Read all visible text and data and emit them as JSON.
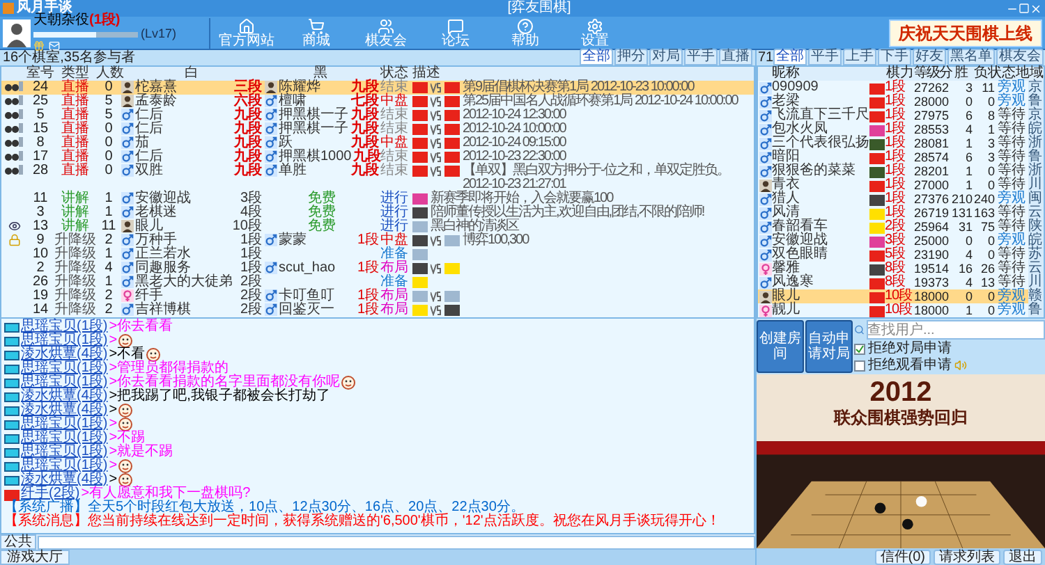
{
  "window": {
    "title": "风月手谈",
    "subtitle": "[弈友围棋]"
  },
  "user": {
    "name": "天朝杂役",
    "rank": "(1段)",
    "level": 0.6,
    "lv": "(Lv17)"
  },
  "nav": [
    {
      "label": "官方网站",
      "kind": "home"
    },
    {
      "label": "商城",
      "kind": "cart"
    },
    {
      "label": "棋友会",
      "kind": "club"
    },
    {
      "label": "论坛",
      "kind": "forum"
    },
    {
      "label": "帮助",
      "kind": "help"
    },
    {
      "label": "设置",
      "kind": "settings"
    }
  ],
  "banner": "庆祝天天围棋上线",
  "games": {
    "title": "16个棋室,35名参与者",
    "tabs": [
      {
        "label": "全部",
        "selected": true
      },
      {
        "label": "押分",
        "selected": false
      },
      {
        "label": "对局",
        "selected": false
      },
      {
        "label": "平手",
        "selected": false
      },
      {
        "label": "直播",
        "selected": false
      }
    ],
    "columns": [
      "室号",
      "类型",
      "人数",
      "白",
      "黑",
      "状态",
      "描述"
    ],
    "rows": [
      {
        "marker": {
          "kind": "live"
        },
        "room": "24",
        "type": {
          "label": "直播",
          "kind": "live"
        },
        "count": "0",
        "white": {
          "name": "柁嘉熹",
          "rank": "三段"
        },
        "black": {
          "name": "陈耀烨",
          "rank": "九段"
        },
        "status": {
          "label": "结束",
          "kind": "ended"
        },
        "icons": [
          {
            "kind": "cn"
          },
          {
            "kind": "cn"
          }
        ],
        "vs": true,
        "text": "第9届倡棋杯决赛第1局 2012-10-23 10:00:00",
        "selected": true
      },
      {
        "marker": {
          "kind": "live"
        },
        "room": "25",
        "type": {
          "label": "直播",
          "kind": "live"
        },
        "count": "5",
        "white": {
          "name": "孟泰龄",
          "rank": "六段"
        },
        "black": {
          "kind": "male",
          "name": "檀啸",
          "rank": "七段"
        },
        "status": {
          "label": "中盘",
          "kind": "mid"
        },
        "icons": [
          {
            "kind": "cn"
          },
          {
            "kind": "cn"
          }
        ],
        "vs": true,
        "text": "第25届中国名人战循环赛第1局 2012-10-24 10:00:00",
        "selected": false
      },
      {
        "marker": {
          "kind": "live"
        },
        "room": "5",
        "type": {
          "label": "直播",
          "kind": "live"
        },
        "count": "5",
        "white": {
          "kind": "male",
          "name": "仁后",
          "rank": "九段"
        },
        "black": {
          "kind": "male",
          "name": "押黑棋一子",
          "rank": "九段"
        },
        "status": {
          "label": "结束",
          "kind": "ended"
        },
        "icons": [
          {
            "kind": "cn"
          },
          {
            "kind": "cn"
          }
        ],
        "vs": true,
        "text": "2012-10-24 12:30:00",
        "selected": false
      },
      {
        "marker": {
          "kind": "live"
        },
        "room": "15",
        "type": {
          "label": "直播",
          "kind": "live"
        },
        "count": "0",
        "white": {
          "kind": "male",
          "name": "仁后",
          "rank": "九段"
        },
        "black": {
          "kind": "male",
          "name": "押黑棋一子",
          "rank": "九段"
        },
        "status": {
          "label": "结束",
          "kind": "ended"
        },
        "icons": [
          {
            "kind": "cn"
          },
          {
            "kind": "cn"
          }
        ],
        "vs": true,
        "text": "2012-10-24 10:00:00",
        "selected": false
      },
      {
        "marker": {
          "kind": "live"
        },
        "room": "8",
        "type": {
          "label": "直播",
          "kind": "live"
        },
        "count": "0",
        "white": {
          "kind": "male",
          "name": "茄",
          "rank": "九段"
        },
        "black": {
          "kind": "male",
          "name": "跃",
          "rank": "九段"
        },
        "status": {
          "label": "中盘",
          "kind": "mid"
        },
        "icons": [
          {
            "kind": "cn"
          },
          {
            "kind": "cn"
          }
        ],
        "vs": true,
        "text": "2012-10-24 09:15:00",
        "selected": false
      },
      {
        "marker": {
          "kind": "live"
        },
        "room": "17",
        "type": {
          "label": "直播",
          "kind": "live"
        },
        "count": "0",
        "white": {
          "kind": "male",
          "name": "仁后",
          "rank": "九段"
        },
        "black": {
          "kind": "male",
          "name": "押黑棋1000",
          "rank": "九段"
        },
        "status": {
          "label": "结束",
          "kind": "ended"
        },
        "icons": [
          {
            "kind": "cn"
          },
          {
            "kind": "cn"
          }
        ],
        "vs": true,
        "text": "2012-10-23 22:30:00",
        "selected": false
      },
      {
        "marker": {
          "kind": "live"
        },
        "room": "28",
        "type": {
          "label": "直播",
          "kind": "live"
        },
        "count": "0",
        "white": {
          "kind": "male",
          "name": "双胜",
          "rank": "九段"
        },
        "black": {
          "kind": "male",
          "name": "单胜",
          "rank": "九段"
        },
        "status": {
          "label": "结束",
          "kind": "ended"
        },
        "icons": [
          {
            "kind": "cn"
          },
          {
            "kind": "cn"
          }
        ],
        "vs": true,
        "text": "【单双】黑白双方押分于-位之和，单双定胜负。 2012-10-23 21:27:01",
        "selected": false
      },
      {
        "room": "11",
        "type": {
          "label": "讲解",
          "kind": "lecture"
        },
        "count": "1",
        "white": {
          "kind": "male",
          "name": "安徽迎战",
          "rank": "3段"
        },
        "free": "免费",
        "status": {
          "label": "进行",
          "kind": "running"
        },
        "icons": [
          {
            "kind": "pink"
          }
        ],
        "vs": false,
        "text": "新赛季即将开始，入会就要赢100",
        "selected": false
      },
      {
        "room": "3",
        "type": {
          "label": "讲解",
          "kind": "lecture"
        },
        "count": "1",
        "white": {
          "kind": "male",
          "name": "老棋迷",
          "rank": "4段"
        },
        "free": "免费",
        "status": {
          "label": "进行",
          "kind": "running"
        },
        "icons": [
          {
            "kind": "black"
          }
        ],
        "vs": false,
        "text": "陪师董传授以生活为主,欢迎自由,团结,不限的陪师!",
        "selected": false
      },
      {
        "marker": {
          "kind": "watch"
        },
        "room": "13",
        "type": {
          "label": "讲解",
          "kind": "lecture"
        },
        "count": "11",
        "white": {
          "name": "眼儿",
          "rank": "10段"
        },
        "free": "免费",
        "status": {
          "label": "进行",
          "kind": "running"
        },
        "icons": [
          {
            "kind": "gray"
          }
        ],
        "vs": false,
        "text": "黑白神的清谈区",
        "selected": false
      },
      {
        "marker": {
          "kind": "lock"
        },
        "room": "9",
        "type": {
          "label": "升降级",
          "kind": "ranked"
        },
        "count": "2",
        "white": {
          "kind": "male",
          "name": "万种手",
          "rank": "1段"
        },
        "black": {
          "kind": "male",
          "name": "蒙蒙",
          "rank": "1段"
        },
        "status": {
          "label": "中盘",
          "kind": "mid"
        },
        "icons": [
          {
            "kind": "black"
          },
          {
            "kind": "gray"
          }
        ],
        "vs": true,
        "text": "博弈100,300",
        "selected": false
      },
      {
        "room": "10",
        "type": {
          "label": "升降级",
          "kind": "ranked"
        },
        "count": "1",
        "white": {
          "kind": "male",
          "name": "正兰若水",
          "rank": "1段"
        },
        "status": {
          "label": "准备",
          "kind": "ready"
        },
        "icons": [
          {
            "kind": "gray"
          }
        ],
        "vs": false,
        "selected": false
      },
      {
        "room": "2",
        "type": {
          "label": "升降级",
          "kind": "ranked"
        },
        "count": "4",
        "white": {
          "kind": "male",
          "name": "同趣服务",
          "rank": "1段"
        },
        "black": {
          "kind": "male",
          "name": "scut_hao",
          "rank": "1段"
        },
        "status": {
          "label": "布局",
          "kind": "opening"
        },
        "icons": [
          {
            "kind": "black"
          },
          {
            "kind": "yellow"
          }
        ],
        "vs": true,
        "selected": false
      },
      {
        "room": "26",
        "type": {
          "label": "升降级",
          "kind": "ranked"
        },
        "count": "1",
        "white": {
          "kind": "male",
          "name": "黑老大的大徒弟",
          "rank": "2段"
        },
        "status": {
          "label": "准备",
          "kind": "ready"
        },
        "icons": [
          {
            "kind": "yellow"
          }
        ],
        "vs": false,
        "selected": false
      },
      {
        "room": "19",
        "type": {
          "label": "升降级",
          "kind": "ranked"
        },
        "count": "2",
        "white": {
          "kind": "female",
          "name": "纤手",
          "rank": "2段"
        },
        "black": {
          "kind": "male",
          "name": "卡叮鱼叮",
          "rank": "1段"
        },
        "status": {
          "label": "布局",
          "kind": "opening"
        },
        "icons": [
          {
            "kind": "gray"
          },
          {
            "kind": "gray"
          }
        ],
        "vs": true,
        "selected": false
      },
      {
        "room": "14",
        "type": {
          "label": "升降级",
          "kind": "ranked"
        },
        "count": "2",
        "white": {
          "kind": "male",
          "name": "吉祥博棋",
          "rank": "2段"
        },
        "black": {
          "kind": "male",
          "name": "回鉴灭一",
          "rank": "1段"
        },
        "status": {
          "label": "布局",
          "kind": "opening"
        },
        "icons": [
          {
            "kind": "yellow"
          },
          {
            "kind": "black"
          }
        ],
        "vs": true,
        "selected": false
      }
    ]
  },
  "chat": [
    {
      "kind": "user",
      "name": "思瑶宝贝(1段)",
      "sep": ">",
      "text": "你去看看",
      "color": "#ff00ff"
    },
    {
      "kind": "user",
      "name": "思瑶宝贝(1段)",
      "sep": ">",
      "emoji": true,
      "color": "#ff00ff"
    },
    {
      "kind": "user",
      "name": "淩水烘蕈(4段)",
      "sep": ">",
      "text": "不看",
      "emoji": true,
      "color": "#000000"
    },
    {
      "kind": "user",
      "name": "思瑶宝贝(1段)",
      "sep": ">",
      "text": "管理员都得捐款的",
      "color": "#ff00ff"
    },
    {
      "kind": "user",
      "name": "思瑶宝贝(1段)",
      "sep": ">",
      "text": "你去看看捐款的名字里面都没有你呢",
      "emoji": true,
      "color": "#ff00ff"
    },
    {
      "kind": "user",
      "name": "淩水烘蕈(4段)",
      "sep": ">",
      "text": "把我踢了吧,我银子都被会长打劫了",
      "color": "#000000"
    },
    {
      "kind": "user",
      "name": "淩水烘蕈(4段)",
      "sep": ">",
      "emoji": true,
      "color": "#000000"
    },
    {
      "kind": "user",
      "name": "思瑶宝贝(1段)",
      "sep": ">",
      "emoji": true,
      "color": "#ff00ff"
    },
    {
      "kind": "user",
      "name": "思瑶宝贝(1段)",
      "sep": ">",
      "text": "不踢",
      "color": "#ff00ff"
    },
    {
      "kind": "user",
      "name": "思瑶宝贝(1段)",
      "sep": ">",
      "text": "就是不踢",
      "color": "#ff00ff"
    },
    {
      "kind": "user",
      "name": "思瑶宝贝(1段)",
      "sep": ">",
      "emoji": true,
      "color": "#ff00ff"
    },
    {
      "kind": "user",
      "name": "淩水烘蕈(4段)",
      "sep": ">",
      "emoji": true,
      "color": "#000000"
    },
    {
      "kind": "user",
      "flag": true,
      "name": "纤手(2段)",
      "sep": ">",
      "text": "有人愿意和我下一盘棋吗?",
      "color": "#ff00ff"
    },
    {
      "kind": "system",
      "text": "【系统广播】全天5个时段红包大放送，10点、12点30分、16点、20点、22点30分。",
      "color": "#0066cc"
    },
    {
      "kind": "system",
      "text": "【系统消息】您当前持续在线达到一定时间，获得系统赠送的'6,500'棋币，'12'点活跃度。祝您在风月手谈玩得开心！",
      "color": "#ff0000"
    }
  ],
  "input": {
    "channel": "公共"
  },
  "status_bar": {
    "tab": "游戏大厅"
  },
  "players": {
    "count": "71",
    "tabs": [
      {
        "label": "全部",
        "selected": true
      },
      {
        "label": "平手",
        "selected": false
      },
      {
        "label": "上手",
        "selected": false
      },
      {
        "label": "下手",
        "selected": false
      },
      {
        "label": "好友",
        "selected": false
      },
      {
        "label": "黑名单",
        "selected": false
      },
      {
        "label": "棋友会",
        "selected": false
      }
    ],
    "columns": [
      "昵称",
      "棋力",
      "等级分",
      "胜",
      "负",
      "状态",
      "地域"
    ],
    "rows": [
      {
        "kind": "male",
        "name": "090909",
        "flag": {
          "kind": "cn"
        },
        "rank": "1段",
        "rating": "27262",
        "wins": "3",
        "losses": "11",
        "status": {
          "label": "旁观",
          "kind": "watch"
        },
        "region": "京",
        "selected": false
      },
      {
        "kind": "male",
        "name": "老梁",
        "flag": {
          "kind": "cn"
        },
        "rank": "1段",
        "rating": "28000",
        "wins": "0",
        "losses": "0",
        "status": {
          "label": "旁观",
          "kind": "watch"
        },
        "region": "鲁",
        "selected": false
      },
      {
        "kind": "male",
        "name": "飞流直下三千尺",
        "flag": {
          "kind": "cn"
        },
        "rank": "1段",
        "rating": "27975",
        "wins": "6",
        "losses": "8",
        "status": {
          "label": "等待",
          "kind": "wait"
        },
        "region": "京",
        "selected": false
      },
      {
        "kind": "male",
        "name": "包水火凤",
        "flag": {
          "kind": "pink"
        },
        "rank": "1段",
        "rating": "28553",
        "wins": "4",
        "losses": "1",
        "status": {
          "label": "等待",
          "kind": "wait"
        },
        "region": "皖",
        "selected": false
      },
      {
        "kind": "male",
        "name": "三个代表很弘扬",
        "flag": {
          "kind": "green"
        },
        "rank": "1段",
        "rating": "28081",
        "wins": "1",
        "losses": "3",
        "status": {
          "label": "等待",
          "kind": "wait"
        },
        "region": "浙",
        "selected": false
      },
      {
        "kind": "male",
        "name": "暗阳",
        "flag": {
          "kind": "cn"
        },
        "rank": "1段",
        "rating": "28574",
        "wins": "6",
        "losses": "3",
        "status": {
          "label": "等待",
          "kind": "wait"
        },
        "region": "鲁",
        "selected": false
      },
      {
        "kind": "male",
        "name": "狠狠爸的菜菜",
        "flag": {
          "kind": "green"
        },
        "rank": "1段",
        "rating": "28201",
        "wins": "1",
        "losses": "0",
        "status": {
          "label": "等待",
          "kind": "wait"
        },
        "region": "浙",
        "selected": false
      },
      {
        "name": "青衣",
        "flag": {
          "kind": "cn"
        },
        "rank": "1段",
        "rating": "27000",
        "wins": "1",
        "losses": "0",
        "status": {
          "label": "等待",
          "kind": "wait"
        },
        "region": "川",
        "selected": false
      },
      {
        "kind": "male",
        "name": "猎人",
        "flag": {
          "kind": "black"
        },
        "rank": "1段",
        "rating": "27376",
        "wins": "210",
        "losses": "240",
        "status": {
          "label": "旁观",
          "kind": "watch"
        },
        "region": "闽",
        "selected": false
      },
      {
        "kind": "male",
        "name": "风清",
        "flag": {
          "kind": "yellow"
        },
        "rank": "1段",
        "rating": "26719",
        "wins": "131",
        "losses": "163",
        "status": {
          "label": "等待",
          "kind": "wait"
        },
        "region": "云",
        "selected": false
      },
      {
        "kind": "male",
        "name": "春韶看车",
        "flag": {
          "kind": "yellow"
        },
        "rank": "2段",
        "rating": "25964",
        "wins": "31",
        "losses": "75",
        "status": {
          "label": "等待",
          "kind": "wait"
        },
        "region": "陕",
        "selected": false
      },
      {
        "kind": "male",
        "name": "安徽迎战",
        "flag": {
          "kind": "pink"
        },
        "rank": "3段",
        "rating": "25000",
        "wins": "0",
        "losses": "0",
        "status": {
          "label": "旁观",
          "kind": "watch"
        },
        "region": "皖",
        "selected": false
      },
      {
        "kind": "male",
        "name": "双色眼睛",
        "flag": {
          "kind": "cn"
        },
        "rank": "5段",
        "rating": "23190",
        "wins": "4",
        "losses": "0",
        "status": {
          "label": "等待",
          "kind": "wait"
        },
        "region": "苏",
        "selected": false
      },
      {
        "kind": "female",
        "name": "馨雅",
        "flag": {
          "kind": "black"
        },
        "rank": "8段",
        "rating": "19514",
        "wins": "16",
        "losses": "26",
        "status": {
          "label": "等待",
          "kind": "wait"
        },
        "region": "云",
        "selected": false
      },
      {
        "kind": "male",
        "name": "风逸寒",
        "flag": {
          "kind": "cn"
        },
        "rank": "8段",
        "rating": "19373",
        "wins": "4",
        "losses": "13",
        "status": {
          "label": "等待",
          "kind": "wait"
        },
        "region": "川",
        "selected": false
      },
      {
        "name": "眼儿",
        "flag": {
          "kind": "cn"
        },
        "rank": "10段",
        "rating": "18000",
        "wins": "0",
        "losses": "0",
        "status": {
          "label": "旁观",
          "kind": "watch"
        },
        "region": "赣",
        "selected": true
      },
      {
        "kind": "female",
        "name": "靓儿",
        "flag": {
          "kind": "cn"
        },
        "rank": "10段",
        "rating": "18000",
        "wins": "1",
        "losses": "0",
        "status": {
          "label": "旁观",
          "kind": "watch"
        },
        "region": "鲁",
        "selected": false
      }
    ]
  },
  "actions": [
    {
      "label": "创建房间"
    },
    {
      "label": "自动申请对局"
    }
  ],
  "search": {
    "placeholder": "查找用户..."
  },
  "options": [
    {
      "label": "拒绝对局申请",
      "checked": true
    },
    {
      "label": "拒绝观看申请",
      "checked": false
    }
  ],
  "promo": {
    "year": "2012",
    "headline": "联众围棋强势回归"
  },
  "bottom_buttons": [
    "信件(0)",
    "请求列表",
    "退出"
  ]
}
